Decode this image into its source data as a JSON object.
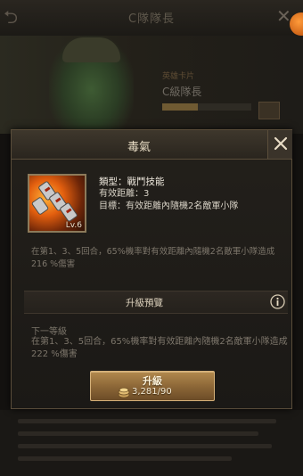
{
  "background": {
    "screen_title": "C隊隊長",
    "hero_subtitle": "英雄卡片",
    "hero_name": "C級隊長"
  },
  "modal": {
    "title": "毒氣",
    "skill": {
      "level_label": "Lv.6",
      "type_line": "類型：戰鬥技能",
      "range_line": "有效距離：3",
      "target_line": "目標：有效距離內隨機2名敵軍小隊"
    },
    "description": "在第1、3、5回合，65%機率對有效距離內隨機2名敵軍小隊造成216 %傷害",
    "upgrade_preview": {
      "title": "升級預覽",
      "next_level_label": "下一等級",
      "next_level_desc": "在第1、3、5回合，65%機率對有效距離內隨機2名敵軍小隊造成222 %傷害"
    },
    "upgrade_button": {
      "label": "升級",
      "cost": "3,281/90"
    }
  },
  "icons": {
    "close": "close-icon",
    "info": "info-icon",
    "coin": "coin-icon",
    "back": "back-arrow-icon",
    "skill": "poison-gas-skill-icon"
  },
  "colors": {
    "accent_gold": "#b2894e",
    "panel_bg": "#1f1c18",
    "text_primary": "#e9ddc6"
  }
}
